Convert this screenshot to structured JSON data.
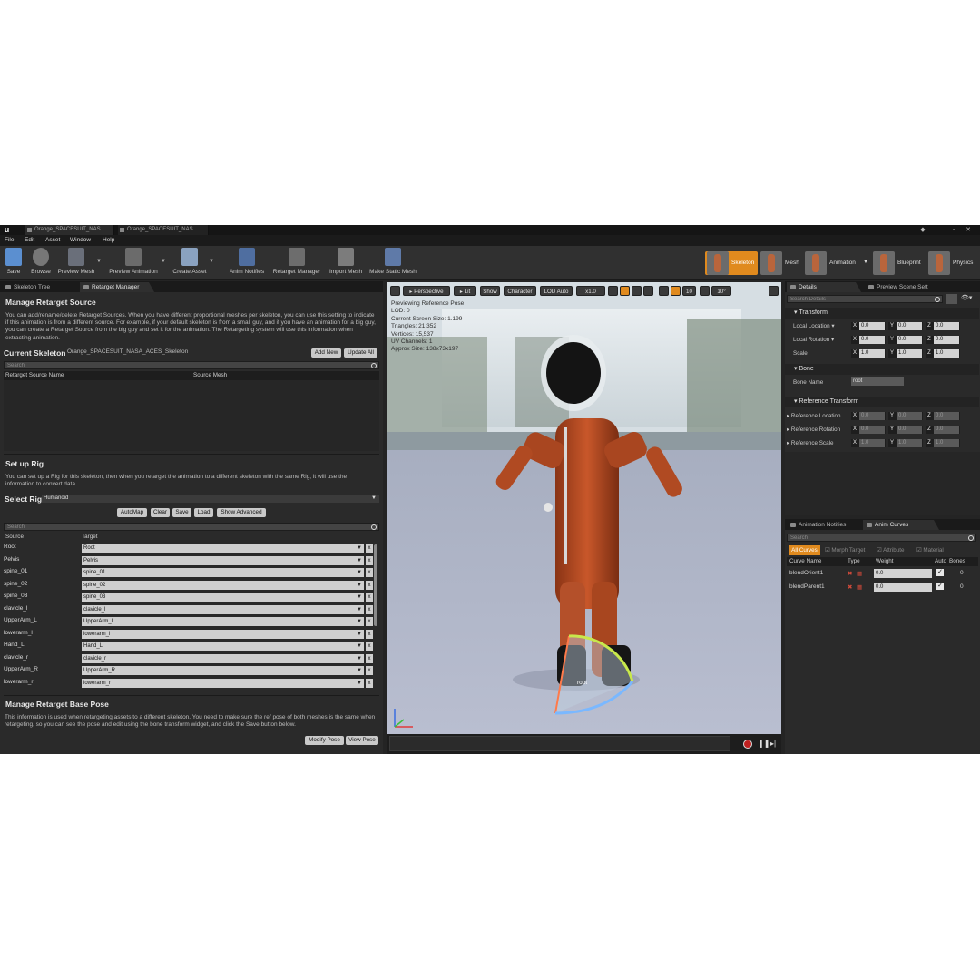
{
  "title_tabs": [
    "Orange_SPACESUIT_NAS..",
    "Orange_SPACESUIT_NAS.."
  ],
  "menu": [
    "File",
    "Edit",
    "Asset",
    "Window",
    "Help"
  ],
  "toolbar": [
    {
      "label": "Save",
      "icon": "save-icon"
    },
    {
      "label": "Browse",
      "icon": "browse-icon"
    },
    {
      "label": "Preview Mesh",
      "icon": "preview-mesh-icon"
    },
    {
      "label": "Preview Animation",
      "icon": "preview-animation-icon"
    },
    {
      "label": "Create Asset",
      "icon": "create-asset-icon"
    },
    {
      "label": "Anim Notifies",
      "icon": "anim-notifies-icon"
    },
    {
      "label": "Retarget Manager",
      "icon": "retarget-manager-icon"
    },
    {
      "label": "Import Mesh",
      "icon": "import-mesh-icon"
    },
    {
      "label": "Make Static Mesh",
      "icon": "make-static-mesh-icon"
    }
  ],
  "modes": [
    "Skeleton",
    "Mesh",
    "Animation",
    "Blueprint",
    "Physics"
  ],
  "left_tabs": [
    "Skeleton Tree",
    "Retarget Manager"
  ],
  "retarget": {
    "title": "Manage Retarget Source",
    "desc": "You can add/rename/delete Retarget Sources. When you have different proportional meshes per skeleton, you can use this setting to indicate if this animation is from a different source. For example, if your default skeleton is from a small guy, and if you have an animation for a big guy, you can create a Retarget Source from the big guy and set it for the animation. The Retargeting system will use this information when extracting animation.",
    "current_skeleton_label": "Current Skeleton",
    "current_skeleton_value": "Orange_SPACESUIT_NASA_ACES_Skeleton",
    "add_new": "Add New",
    "update_all": "Update All",
    "search_placeholder": "Search",
    "col_source_name": "Retarget Source Name",
    "col_source_mesh": "Source Mesh"
  },
  "rig": {
    "title": "Set up Rig",
    "desc": "You can set up a Rig for this skeleton, then when you retarget the animation to a different skeleton with the same Rig, it will use the information to convert data.",
    "select_label": "Select Rig",
    "select_value": "Humanoid",
    "buttons": [
      "AutoMap",
      "Clear",
      "Save",
      "Load",
      "Show Advanced"
    ],
    "search_placeholder": "Search",
    "col_source": "Source",
    "col_target": "Target",
    "rows": [
      {
        "source": "Root",
        "target": "Root"
      },
      {
        "source": "Pelvis",
        "target": "Pelvis"
      },
      {
        "source": "spine_01",
        "target": "spine_01"
      },
      {
        "source": "spine_02",
        "target": "spine_02"
      },
      {
        "source": "spine_03",
        "target": "spine_03"
      },
      {
        "source": "clavicle_l",
        "target": "clavicle_l"
      },
      {
        "source": "UpperArm_L",
        "target": "UpperArm_L"
      },
      {
        "source": "lowerarm_l",
        "target": "lowerarm_l"
      },
      {
        "source": "Hand_L",
        "target": "Hand_L"
      },
      {
        "source": "clavicle_r",
        "target": "clavicle_r"
      },
      {
        "source": "UpperArm_R",
        "target": "UpperArm_R"
      },
      {
        "source": "lowerarm_r",
        "target": "lowerarm_r"
      }
    ],
    "remove_glyph": "x"
  },
  "base_pose": {
    "title": "Manage Retarget Base Pose",
    "desc": "This information is used when retargeting assets to a different skeleton. You need to make sure the ref pose of both meshes is the same when retargeting, so you can see the pose and edit using the bone transform widget, and click the Save button below.",
    "modify": "Modify Pose",
    "view": "View Pose"
  },
  "viewport": {
    "perspective": "Perspective",
    "lit": "Lit",
    "show": "Show",
    "character": "Character",
    "lod": "LOD Auto",
    "speed": "x1.0",
    "grid": "10",
    "angle": "10°",
    "stats": [
      "Previewing Reference Pose",
      "LOD: 0",
      "Current Screen Size: 1.199",
      "Triangles: 21,352",
      "Vertices: 15,537",
      "UV Channels: 1",
      "Approx Size: 138x73x197"
    ],
    "bone_label": "root"
  },
  "right_tabs": [
    "Details",
    "Preview Scene Sett"
  ],
  "details": {
    "search_placeholder": "Search Details",
    "transform": "Transform",
    "local_location": "Local Location",
    "local_rotation": "Local Rotation",
    "scale": "Scale",
    "bone": "Bone",
    "bone_name_label": "Bone Name",
    "bone_name_value": "root",
    "reference_transform": "Reference Transform",
    "reference_location": "Reference Location",
    "reference_rotation": "Reference Rotation",
    "reference_scale": "Reference Scale",
    "vectors": {
      "loc": [
        "0.0",
        "0.0",
        "0.0"
      ],
      "rot": [
        "0.0",
        "0.0",
        "0.0"
      ],
      "scale": [
        "1.0",
        "1.0",
        "1.0"
      ],
      "rloc": [
        "0.0",
        "0.0",
        "0.0"
      ],
      "rrot": [
        "0.0",
        "0.0",
        "0.0"
      ],
      "rscale": [
        "1.0",
        "1.0",
        "1.0"
      ]
    },
    "axes": [
      "X",
      "Y",
      "Z"
    ]
  },
  "curves_tabs": [
    "Animation Notifies",
    "Anim Curves"
  ],
  "curves": {
    "search_placeholder": "Search",
    "filters": [
      "All Curves",
      "Morph Target",
      "Attribute",
      "Material"
    ],
    "cols": [
      "Curve Name",
      "Type",
      "Weight",
      "Auto",
      "Bones"
    ],
    "rows": [
      {
        "name": "blendOrient1",
        "weight": "0.0",
        "bones": "0"
      },
      {
        "name": "blendParent1",
        "weight": "0.0",
        "bones": "0"
      }
    ]
  },
  "colors": {
    "accent": "#e08a1e",
    "panel": "#2a2a2a",
    "bg": "#242424"
  }
}
